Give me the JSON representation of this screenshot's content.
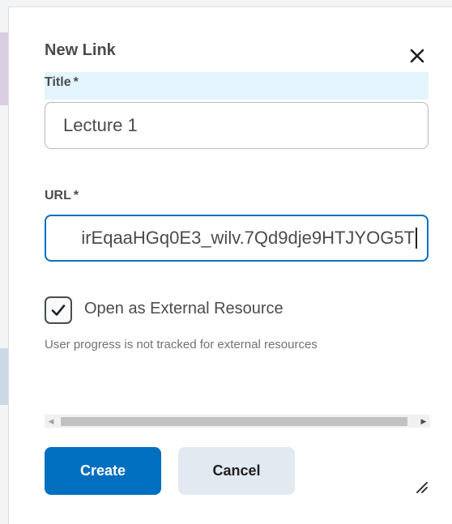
{
  "dialog": {
    "title": "New Link",
    "close_icon": "close-icon"
  },
  "form": {
    "title_field": {
      "label": "Title",
      "required_mark": "*",
      "value": "Lecture 1"
    },
    "url_field": {
      "label": "URL",
      "required_mark": "*",
      "value": "irEqaaHGq0E3_wilv.7Qd9dje9HTJYOG5T"
    },
    "external_resource": {
      "label": "Open as External Resource",
      "checked": true,
      "help_text": "User progress is not tracked for external resources"
    }
  },
  "actions": {
    "create_label": "Create",
    "cancel_label": "Cancel"
  },
  "colors": {
    "primary": "#006fbf",
    "secondary_button": "#e3e9f1",
    "label_highlight": "#e4f4fd",
    "text": "#494c4e"
  },
  "icons": {
    "close": "close-icon",
    "checkbox": "checkmark-icon",
    "resize": "resize-handle-icon"
  }
}
